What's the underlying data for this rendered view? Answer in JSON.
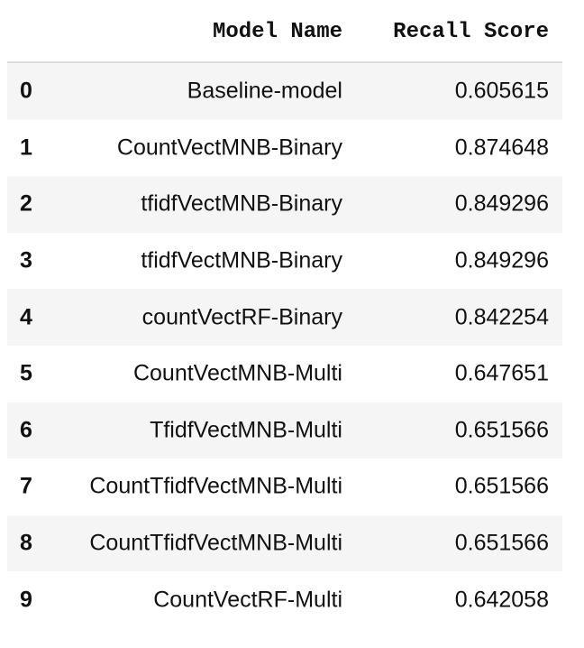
{
  "table": {
    "columns": [
      "Model Name",
      "Recall Score"
    ],
    "rows": [
      {
        "index": "0",
        "model": "Baseline-model",
        "recall": "0.605615"
      },
      {
        "index": "1",
        "model": "CountVectMNB-Binary",
        "recall": "0.874648"
      },
      {
        "index": "2",
        "model": "tfidfVectMNB-Binary",
        "recall": "0.849296"
      },
      {
        "index": "3",
        "model": "tfidfVectMNB-Binary",
        "recall": "0.849296"
      },
      {
        "index": "4",
        "model": "countVectRF-Binary",
        "recall": "0.842254"
      },
      {
        "index": "5",
        "model": "CountVectMNB-Multi",
        "recall": "0.647651"
      },
      {
        "index": "6",
        "model": "TfidfVectMNB-Multi",
        "recall": "0.651566"
      },
      {
        "index": "7",
        "model": "CountTfidfVectMNB-Multi",
        "recall": "0.651566"
      },
      {
        "index": "8",
        "model": "CountTfidfVectMNB-Multi",
        "recall": "0.651566"
      },
      {
        "index": "9",
        "model": "CountVectRF-Multi",
        "recall": "0.642058"
      }
    ]
  }
}
